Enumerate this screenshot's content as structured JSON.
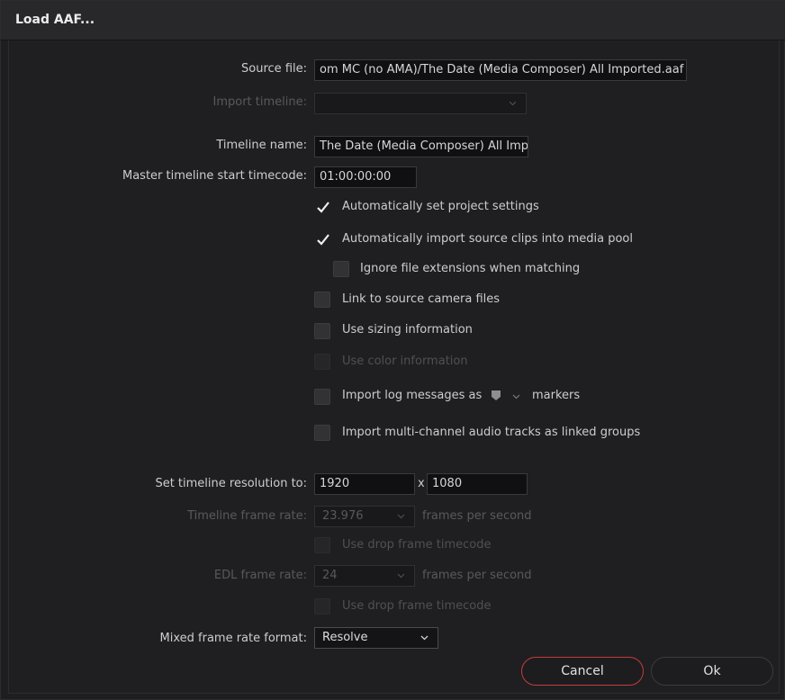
{
  "dialog": {
    "title": "Load AAF..."
  },
  "form": {
    "source_file_label": "Source file:",
    "source_file_value": "om MC (no AMA)/The Date (Media Composer) All Imported.aaf",
    "import_timeline_label": "Import timeline:",
    "import_timeline_value": "",
    "timeline_name_label": "Timeline name:",
    "timeline_name_value": "The Date (Media Composer) All Imp",
    "master_tc_label": "Master timeline start timecode:",
    "master_tc_value": "01:00:00:00",
    "checkboxes": [
      {
        "label": "Automatically set project settings",
        "checked": true,
        "enabled": true
      },
      {
        "label": "Automatically import source clips into media pool",
        "checked": true,
        "enabled": true
      },
      {
        "label": "Ignore file extensions when matching",
        "checked": false,
        "enabled": true
      },
      {
        "label": "Link to source camera files",
        "checked": false,
        "enabled": true
      },
      {
        "label": "Use sizing information",
        "checked": false,
        "enabled": true
      },
      {
        "label": "Use color information",
        "checked": false,
        "enabled": false
      },
      {
        "label": "Import log messages as",
        "checked": false,
        "enabled": true
      },
      {
        "label": "Import multi-channel audio tracks as linked groups",
        "checked": false,
        "enabled": true
      }
    ],
    "markers_suffix": "markers",
    "resolution_label": "Set timeline resolution to:",
    "resolution_width": "1920",
    "resolution_x": "x",
    "resolution_height": "1080",
    "timeline_fps_label": "Timeline frame rate:",
    "timeline_fps_value": "23.976",
    "fps_suffix": "frames per second",
    "drop_frame_label": "Use drop frame timecode",
    "edl_fps_label": "EDL frame rate:",
    "edl_fps_value": "24",
    "edl_fps_suffix": "frames per second",
    "edl_drop_frame_label": "Use drop frame timecode",
    "mixed_rate_label": "Mixed frame rate format:",
    "mixed_rate_value": "Resolve"
  },
  "buttons": {
    "cancel": "Cancel",
    "ok": "Ok"
  },
  "colors": {
    "cancel_border": "#c43c3c",
    "marker_color": "#8e8e92"
  }
}
